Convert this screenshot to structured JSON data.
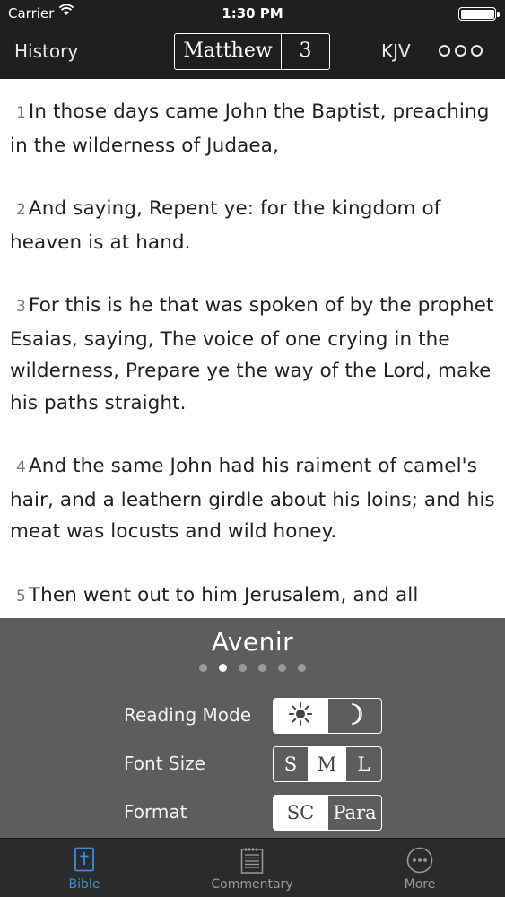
{
  "status_bar": {
    "carrier": "Carrier",
    "time": "1:30 PM"
  },
  "nav": {
    "history_label": "History",
    "book": "Matthew",
    "chapter": "3",
    "version": "KJV"
  },
  "verses": [
    {
      "number": "1",
      "text": "In those days came John the Baptist, preaching in the wilderness of Judaea,"
    },
    {
      "number": "2",
      "text": "And saying, Repent ye: for the kingdom of heaven is at hand."
    },
    {
      "number": "3",
      "text": "For this is he that was spoken of by the prophet Esaias, saying, The voice of one crying in the wilderness, Prepare ye the way of the Lord, make his paths straight."
    },
    {
      "number": "4",
      "text": "And the same John had his raiment of camel's hair, and a leathern girdle about his loins; and his meat was locusts and wild honey."
    },
    {
      "number": "5",
      "text": "Then went out to him Jerusalem, and all Judaea, and all the region round about"
    }
  ],
  "settings": {
    "font_name": "Avenir",
    "font_page_index": 1,
    "font_page_count": 6,
    "reading_mode": {
      "label": "Reading Mode",
      "selected": "day",
      "day_icon": "sun-icon",
      "night_icon": "moon-icon"
    },
    "font_size": {
      "label": "Font Size",
      "options": [
        "S",
        "M",
        "L"
      ],
      "selected": "M"
    },
    "format": {
      "label": "Format",
      "options": [
        "SC",
        "Para"
      ],
      "selected": "SC"
    }
  },
  "tabs": [
    {
      "label": "Bible",
      "icon": "bible-icon",
      "active": true
    },
    {
      "label": "Commentary",
      "icon": "commentary-icon",
      "active": false
    },
    {
      "label": "More",
      "icon": "more-icon",
      "active": false
    }
  ],
  "colors": {
    "header_bg": "#1f1f1f",
    "panel_bg": "#5d5d5d",
    "tabbar_bg": "#2b2b2b",
    "active_tab": "#3b8fd9"
  }
}
